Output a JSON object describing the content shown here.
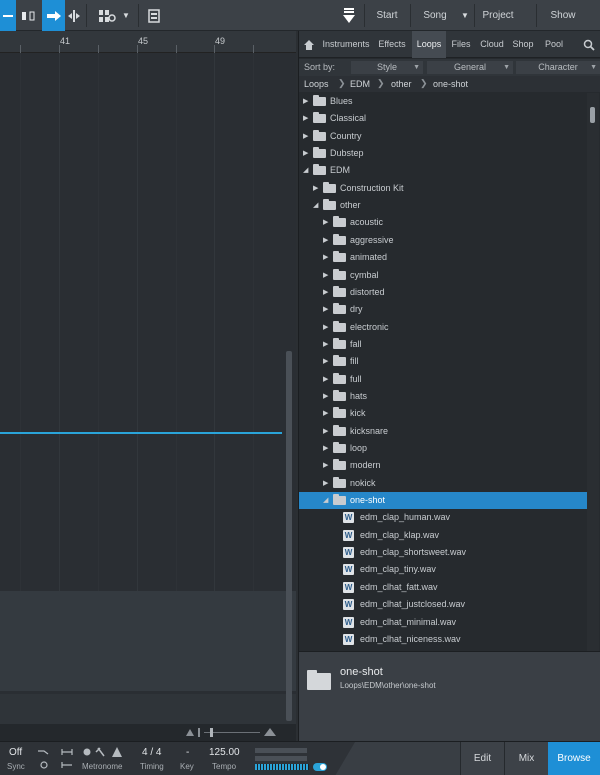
{
  "toolbar": {
    "right_buttons": [
      "Start",
      "Song",
      "Project",
      "Show"
    ]
  },
  "ruler": [
    "41",
    "45",
    "49"
  ],
  "browser": {
    "tabs": [
      "Instruments",
      "Effects",
      "Loops",
      "Files",
      "Cloud",
      "Shop",
      "Pool"
    ],
    "active_tab": "Loops",
    "sort_by_label": "Sort by:",
    "sort_options": [
      "Style",
      "General",
      "Character"
    ],
    "breadcrumb": [
      "Loops",
      "EDM",
      "other",
      "one-shot"
    ],
    "tree": [
      {
        "label": "Blues",
        "type": "folder",
        "depth": 0,
        "open": false
      },
      {
        "label": "Classical",
        "type": "folder",
        "depth": 0,
        "open": false
      },
      {
        "label": "Country",
        "type": "folder",
        "depth": 0,
        "open": false
      },
      {
        "label": "Dubstep",
        "type": "folder",
        "depth": 0,
        "open": false
      },
      {
        "label": "EDM",
        "type": "folder",
        "depth": 0,
        "open": true
      },
      {
        "label": "Construction Kit",
        "type": "folder",
        "depth": 1,
        "open": false
      },
      {
        "label": "other",
        "type": "folder",
        "depth": 1,
        "open": true
      },
      {
        "label": "acoustic",
        "type": "folder",
        "depth": 2,
        "open": false
      },
      {
        "label": "aggressive",
        "type": "folder",
        "depth": 2,
        "open": false
      },
      {
        "label": "animated",
        "type": "folder",
        "depth": 2,
        "open": false
      },
      {
        "label": "cymbal",
        "type": "folder",
        "depth": 2,
        "open": false
      },
      {
        "label": "distorted",
        "type": "folder",
        "depth": 2,
        "open": false
      },
      {
        "label": "dry",
        "type": "folder",
        "depth": 2,
        "open": false
      },
      {
        "label": "electronic",
        "type": "folder",
        "depth": 2,
        "open": false
      },
      {
        "label": "fall",
        "type": "folder",
        "depth": 2,
        "open": false
      },
      {
        "label": "fill",
        "type": "folder",
        "depth": 2,
        "open": false
      },
      {
        "label": "full",
        "type": "folder",
        "depth": 2,
        "open": false
      },
      {
        "label": "hats",
        "type": "folder",
        "depth": 2,
        "open": false
      },
      {
        "label": "kick",
        "type": "folder",
        "depth": 2,
        "open": false
      },
      {
        "label": "kicksnare",
        "type": "folder",
        "depth": 2,
        "open": false
      },
      {
        "label": "loop",
        "type": "folder",
        "depth": 2,
        "open": false
      },
      {
        "label": "modern",
        "type": "folder",
        "depth": 2,
        "open": false
      },
      {
        "label": "nokick",
        "type": "folder",
        "depth": 2,
        "open": false
      },
      {
        "label": "one-shot",
        "type": "folder",
        "depth": 2,
        "open": true,
        "selected": true
      },
      {
        "label": "edm_clap_human.wav",
        "type": "file",
        "depth": 3
      },
      {
        "label": "edm_clap_klap.wav",
        "type": "file",
        "depth": 3
      },
      {
        "label": "edm_clap_shortsweet.wav",
        "type": "file",
        "depth": 3
      },
      {
        "label": "edm_clap_tiny.wav",
        "type": "file",
        "depth": 3
      },
      {
        "label": "edm_clhat_fatt.wav",
        "type": "file",
        "depth": 3
      },
      {
        "label": "edm_clhat_justclosed.wav",
        "type": "file",
        "depth": 3
      },
      {
        "label": "edm_clhat_minimal.wav",
        "type": "file",
        "depth": 3
      },
      {
        "label": "edm_clhat_niceness.wav",
        "type": "file",
        "depth": 3
      }
    ],
    "info": {
      "name": "one-shot",
      "path": "Loops\\EDM\\other\\one-shot"
    }
  },
  "transport": {
    "sync_value": "Off",
    "sync_label": "Sync",
    "metronome_label": "Metronome",
    "timing_value": "4 / 4",
    "timing_label": "Timing",
    "key_value": "-",
    "key_label": "Key",
    "tempo_value": "125.00",
    "tempo_label": "Tempo",
    "buttons": [
      "Edit",
      "Mix",
      "Browse"
    ],
    "active_button": "Browse"
  },
  "colors": {
    "accent": "#1e8fd6",
    "selection": "#2687c9",
    "automation_line": "#2aa4d9"
  }
}
